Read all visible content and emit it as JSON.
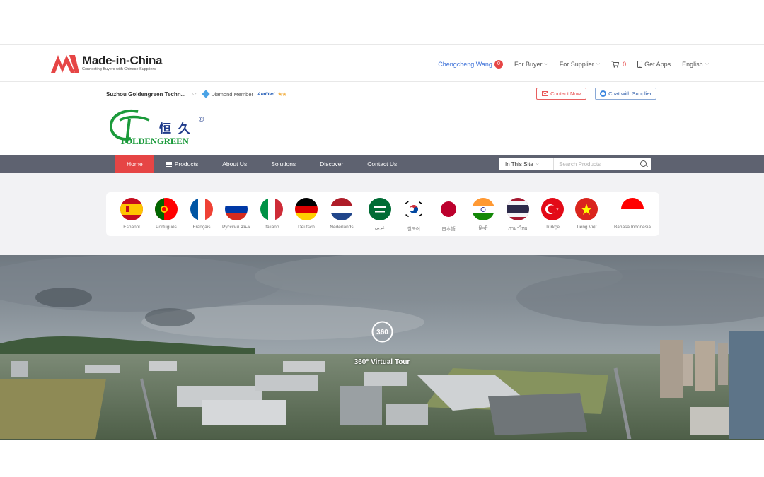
{
  "header": {
    "logo_text": "Made-in-China",
    "logo_tagline": "Connecting Buyers with Chinese Suppliers",
    "user_name": "Chengcheng Wang",
    "user_badge": "0",
    "for_buyer": "For Buyer",
    "for_supplier": "For Supplier",
    "cart_count": "0",
    "get_apps": "Get Apps",
    "language": "English",
    "brand_color": "#e64545"
  },
  "supplier": {
    "name": "Suzhou Goldengreen Techn...",
    "membership": "Diamond Member",
    "audited": "Audited",
    "stars": "★★",
    "contact_now": "Contact Now",
    "chat_with_supplier": "Chat with Supplier"
  },
  "brand": {
    "chinese": "恒 久",
    "latin": "TOLDENGREEN",
    "registered": "®",
    "color": "#1a9a3a"
  },
  "nav": {
    "items": [
      {
        "label": "Home",
        "active": true
      },
      {
        "label": "Products"
      },
      {
        "label": "About Us"
      },
      {
        "label": "Solutions"
      },
      {
        "label": "Discover"
      },
      {
        "label": "Contact Us"
      }
    ],
    "scope": "In This Site",
    "search_placeholder": "Search Products",
    "bg_color": "#5e6270"
  },
  "languages": [
    {
      "label": "Español",
      "flag": "es"
    },
    {
      "label": "Português",
      "flag": "pt"
    },
    {
      "label": "Français",
      "flag": "fr"
    },
    {
      "label": "Русский язык",
      "flag": "ru"
    },
    {
      "label": "Italiano",
      "flag": "it"
    },
    {
      "label": "Deutsch",
      "flag": "de"
    },
    {
      "label": "Nederlands",
      "flag": "nl"
    },
    {
      "label": "عربي",
      "flag": "sa"
    },
    {
      "label": "한국어",
      "flag": "kr"
    },
    {
      "label": "日本語",
      "flag": "jp"
    },
    {
      "label": "हिन्दी",
      "flag": "in"
    },
    {
      "label": "ภาษาไทย",
      "flag": "th"
    },
    {
      "label": "Türkçe",
      "flag": "tr"
    },
    {
      "label": "Tiếng Việt",
      "flag": "vn"
    },
    {
      "label": "Bahasa Indonesia",
      "flag": "id"
    }
  ],
  "tour": {
    "icon_text": "360",
    "label": "360° Virtual Tour"
  }
}
